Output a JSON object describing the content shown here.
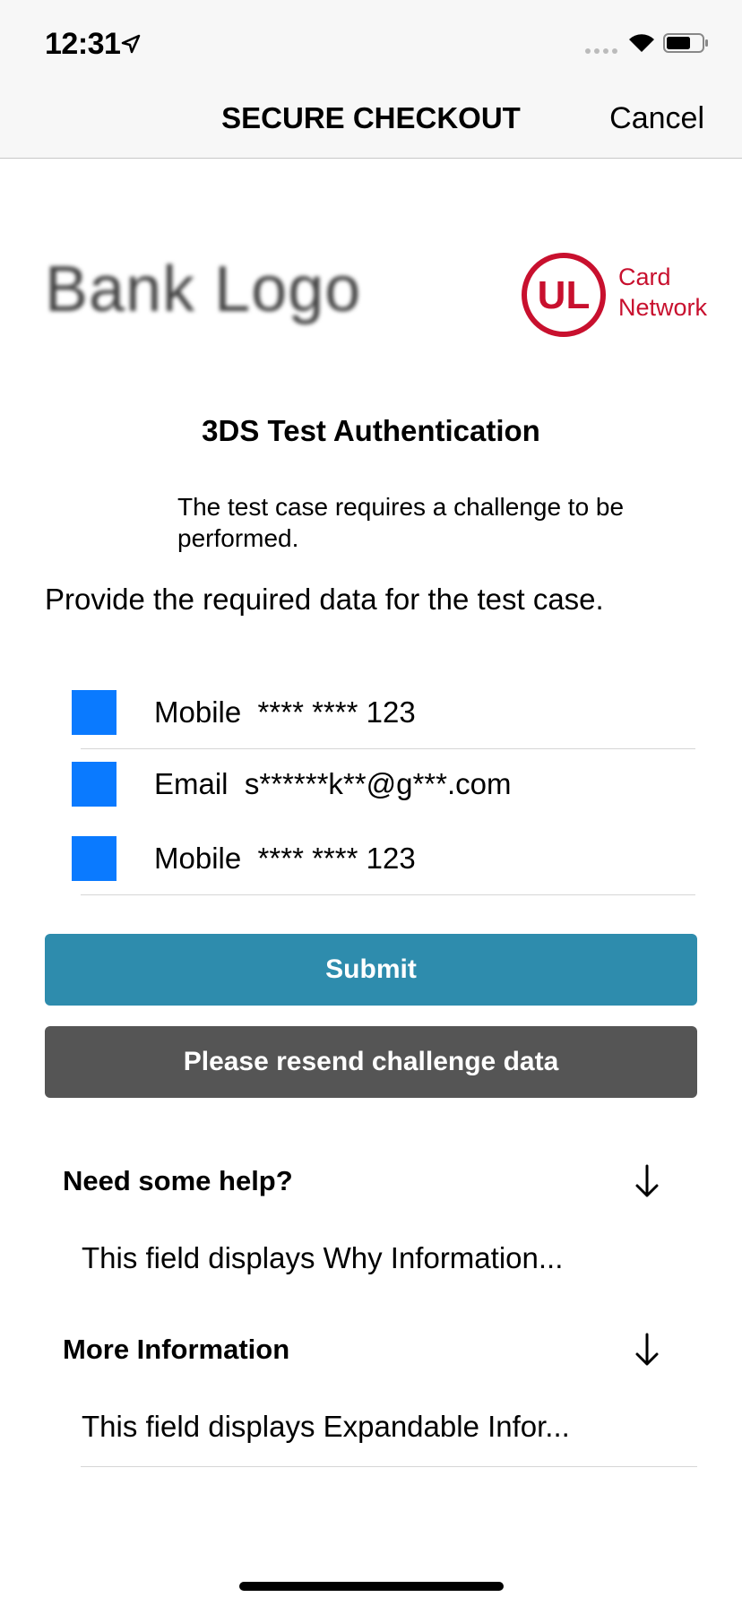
{
  "status_bar": {
    "time": "12:31",
    "icons": [
      "location-arrow-icon",
      "signal-icon",
      "wifi-icon",
      "battery-icon"
    ]
  },
  "nav": {
    "title": "SECURE CHECKOUT",
    "cancel_label": "Cancel"
  },
  "logos": {
    "bank_logo_text": "Bank Logo",
    "network_logo_mark": "UL",
    "network_logo_line1": "Card",
    "network_logo_line2": "Network"
  },
  "challenge": {
    "heading": "3DS Test Authentication",
    "info": "The test case requires a challenge to be performed.",
    "instruction": "Provide the required data for the test case."
  },
  "options": [
    {
      "label": "Mobile  **** **** 123"
    },
    {
      "label": "Email  s******k**@g***.com"
    },
    {
      "label": "Mobile  **** **** 123"
    }
  ],
  "buttons": {
    "submit": "Submit",
    "resend": "Please resend challenge data"
  },
  "help": {
    "title": "Need some help?",
    "text": "This field displays Why Information...",
    "icon": "arrow-down-icon"
  },
  "more_info": {
    "title": "More Information",
    "text": "This field displays Expandable Infor...",
    "icon": "arrow-down-icon"
  },
  "colors": {
    "option_box": "#0a7aff",
    "submit_bg": "#2e8cad",
    "resend_bg": "#555555",
    "network_red": "#c8102e"
  }
}
